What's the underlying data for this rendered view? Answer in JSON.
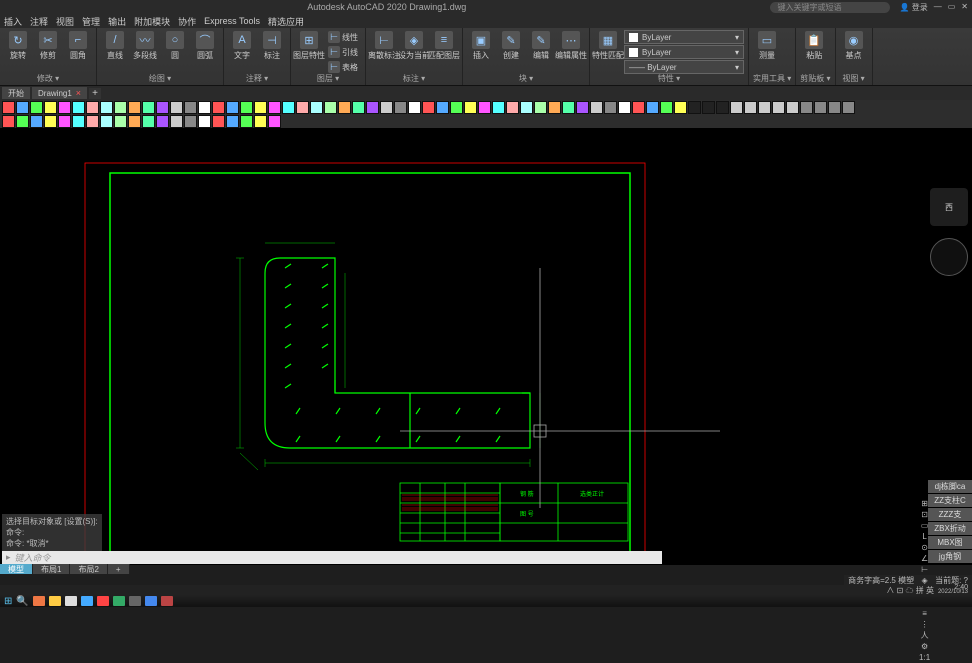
{
  "app": {
    "title": "Autodesk AutoCAD 2020  Drawing1.dwg",
    "search_placeholder": "键入关键字或短语",
    "login": "登录"
  },
  "menu": [
    "插入",
    "注释",
    "视图",
    "管理",
    "输出",
    "附加模块",
    "协作",
    "Express Tools",
    "精选应用"
  ],
  "ribbon": {
    "panels": [
      {
        "label": "修改",
        "items": [
          {
            "icon": "↻",
            "text": "旋转"
          },
          {
            "icon": "✂",
            "text": "修剪"
          },
          {
            "icon": "⌐",
            "text": "圆角"
          }
        ]
      },
      {
        "label": "绘图",
        "items": [
          {
            "icon": "/",
            "text": "直线"
          },
          {
            "icon": "〰",
            "text": "多段线"
          },
          {
            "icon": "○",
            "text": "圆"
          },
          {
            "icon": "⌒",
            "text": "圆弧"
          }
        ]
      },
      {
        "label": "注释",
        "items": [
          {
            "icon": "A",
            "text": "文字"
          },
          {
            "icon": "⊣",
            "text": "标注"
          }
        ]
      },
      {
        "label": "图层",
        "items": [
          {
            "icon": "⊞",
            "text": "图层特性"
          },
          {
            "combo_lines": [
              "线性",
              "引线",
              "表格"
            ]
          }
        ]
      },
      {
        "label": "标注",
        "items": [
          {
            "icon": "⊢",
            "text": "离散标注"
          },
          {
            "icon": "◈",
            "text": "设为当前"
          },
          {
            "icon": "≡",
            "text": "匹配图层"
          }
        ]
      },
      {
        "label": "块",
        "items": [
          {
            "icon": "▣",
            "text": "插入"
          },
          {
            "icon": "✎",
            "text": "创建"
          },
          {
            "icon": "✎",
            "text": "编辑"
          },
          {
            "icon": "⋯",
            "text": "编辑属性"
          }
        ]
      },
      {
        "label": "特性",
        "items": [
          {
            "icon": "▦",
            "text": "特性匹配"
          }
        ],
        "layers": [
          {
            "color": "#fff",
            "name": "ByLayer"
          },
          {
            "color": "#fff",
            "name": "ByLayer"
          },
          {
            "color": "",
            "name": "ByLayer"
          }
        ]
      },
      {
        "label": "实用工具",
        "items": [
          {
            "icon": "▭",
            "text": "测量"
          }
        ]
      },
      {
        "label": "剪贴板",
        "items": [
          {
            "icon": "📋",
            "text": "粘贴"
          }
        ]
      },
      {
        "label": "视图",
        "items": [
          {
            "icon": "◉",
            "text": "基点"
          }
        ]
      }
    ]
  },
  "filetabs": [
    {
      "name": "开始",
      "close": false
    },
    {
      "name": "Drawing1",
      "close": true
    }
  ],
  "toolstrip_colors": [
    "#f55",
    "#5af",
    "#5f5",
    "#ff5",
    "#f5f",
    "#5ff",
    "#faa",
    "#aff",
    "#afa",
    "#fa5",
    "#5fa",
    "#a5f",
    "#ccc",
    "#888",
    "#fff",
    "#f55",
    "#5af",
    "#5f5",
    "#ff5",
    "#f5f",
    "#5ff",
    "#faa",
    "#aff",
    "#afa",
    "#fa5",
    "#5fa",
    "#a5f",
    "#ccc",
    "#888",
    "#fff",
    "#f55",
    "#5af",
    "#5f5",
    "#ff5",
    "#f5f",
    "#5ff",
    "#faa",
    "#aff",
    "#afa",
    "#fa5",
    "#5fa",
    "#a5f",
    "#ccc",
    "#888",
    "#fff",
    "#f55",
    "#5af",
    "#5f5",
    "#ff5",
    "#222",
    "#222",
    "#222",
    "#ccc",
    "#ccc",
    "#ccc",
    "#ccc",
    "#ccc",
    "#888",
    "#888",
    "#888",
    "#888"
  ],
  "toolstrip2_colors": [
    "#f55",
    "#5f5",
    "#5af",
    "#ff5",
    "#f5f",
    "#5ff",
    "#faa",
    "#aff",
    "#afa",
    "#fa5",
    "#5fa",
    "#a5f",
    "#ccc",
    "#888",
    "#fff",
    "#f55",
    "#5af",
    "#5f5",
    "#ff5",
    "#f5f"
  ],
  "viewcube": "西",
  "cmd": {
    "history": [
      "选择目标对象或 [设置(S)]:",
      "命令:",
      "命令: *取消*"
    ],
    "prompt": "▸",
    "placeholder": "键入命令"
  },
  "model_tabs": [
    {
      "name": "模型",
      "active": true
    },
    {
      "name": "布局1",
      "active": false
    },
    {
      "name": "布局2",
      "active": false
    }
  ],
  "status": {
    "left": "商务字高=2.5  模塑",
    "snap_count": "当前题: ?",
    "items": [
      "⊞",
      "⊡",
      "▭",
      "L",
      "⊙",
      "∠",
      "⊢",
      "◈",
      "▦",
      "⊥",
      "≡",
      "⋮",
      "人",
      "⚙",
      "1:1"
    ]
  },
  "right_buttons": [
    "dj栋脚ca",
    "ZZ支柱C",
    "ZZZ支",
    "ZBX折动",
    "MBX图",
    "jg角钢"
  ],
  "clock": {
    "time": "2:40",
    "date": "2022/10/13"
  },
  "tray": "∧ ⊡ ☁ 拼 英"
}
